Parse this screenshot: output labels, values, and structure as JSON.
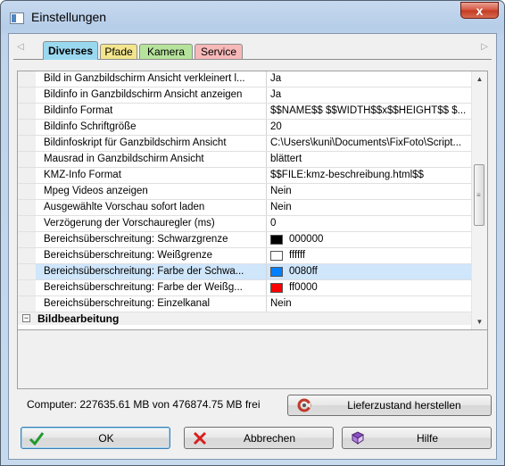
{
  "window": {
    "title": "Einstellungen",
    "close_glyph": "x"
  },
  "tabs": [
    {
      "label": "Diverses",
      "color": "#9ad8f0",
      "active": true
    },
    {
      "label": "Pfade",
      "color": "#f3e58c",
      "active": false
    },
    {
      "label": "Kamera",
      "color": "#b6e39c",
      "active": false
    },
    {
      "label": "Service",
      "color": "#f7b8b8",
      "active": false
    }
  ],
  "tab_scroll": {
    "left": "◁",
    "right": "▷"
  },
  "properties": [
    {
      "name": "Bild in Ganzbildschirm Ansicht verkleinert l...",
      "value": "Ja"
    },
    {
      "name": "Bildinfo in Ganzbildschirm Ansicht anzeigen",
      "value": "Ja"
    },
    {
      "name": "Bildinfo Format",
      "value": "$$NAME$$ $$WIDTH$$x$$HEIGHT$$ $..."
    },
    {
      "name": "Bildinfo Schriftgröße",
      "value": "20"
    },
    {
      "name": "Bildinfoskript für Ganzbildschirm Ansicht",
      "value": "C:\\Users\\kuni\\Documents\\FixFoto\\Script..."
    },
    {
      "name": "Mausrad in Ganzbildschirm Ansicht",
      "value": "blättert"
    },
    {
      "name": "KMZ-Info Format",
      "value": "$$FILE:kmz-beschreibung.html$$"
    },
    {
      "name": "Mpeg Videos anzeigen",
      "value": "Nein"
    },
    {
      "name": "Ausgewählte Vorschau sofort laden",
      "value": "Nein"
    },
    {
      "name": "Verzögerung der Vorschauregler (ms)",
      "value": "0"
    },
    {
      "name": "Bereichsüberschreitung: Schwarzgrenze",
      "value": "000000",
      "color": "#000000"
    },
    {
      "name": "Bereichsüberschreitung: Weißgrenze",
      "value": "ffffff",
      "color": "#ffffff"
    },
    {
      "name": "Bereichsüberschreitung: Farbe der Schwa...",
      "value": "0080ff",
      "color": "#0080ff"
    },
    {
      "name": "Bereichsüberschreitung: Farbe der Weißg...",
      "value": "ff0000",
      "color": "#ff0000"
    },
    {
      "name": "Bereichsüberschreitung: Einzelkanal",
      "value": "Nein"
    }
  ],
  "category": {
    "toggle": "−",
    "name": "Bildbearbeitung"
  },
  "status": {
    "text": "Computer: 227635.61 MB von 476874.75 MB frei"
  },
  "buttons": {
    "reset": "Lieferzustand herstellen",
    "ok": "OK",
    "cancel": "Abbrechen",
    "help": "Hilfe"
  },
  "accent_colors": {
    "ok_check": "#1f9a2c",
    "cancel_x": "#d81e1e",
    "help_book": "#8a4fc0",
    "reset_icon": "#c0392b"
  },
  "selected_row_index": 12
}
